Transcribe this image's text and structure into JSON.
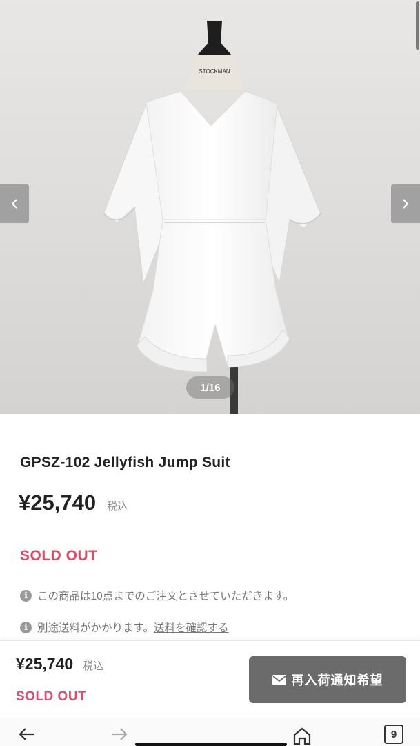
{
  "gallery": {
    "counter": "1/16",
    "mannequin_brand": "STOCKMAN",
    "prev_icon": "chevron-left-icon",
    "next_icon": "chevron-right-icon"
  },
  "product": {
    "title": "GPSZ-102 Jellyfish Jump Suit",
    "price": "¥25,740",
    "tax_label": "税込",
    "status": "SOLD OUT",
    "note1": "この商品は10点までのご注文とさせていただきます。",
    "note2_text": "別途送料がかかります。",
    "note2_link": "送料を確認する",
    "info_icon_glyph": "i"
  },
  "sticky_bar": {
    "price": "¥25,740",
    "tax_label": "税込",
    "status": "SOLD OUT",
    "restock_button": "再入荷通知希望"
  },
  "browser": {
    "tab_count": "9"
  },
  "colors": {
    "sold_out": "#e04a6a",
    "button_bg": "#6b6b6b",
    "text": "#222222"
  }
}
